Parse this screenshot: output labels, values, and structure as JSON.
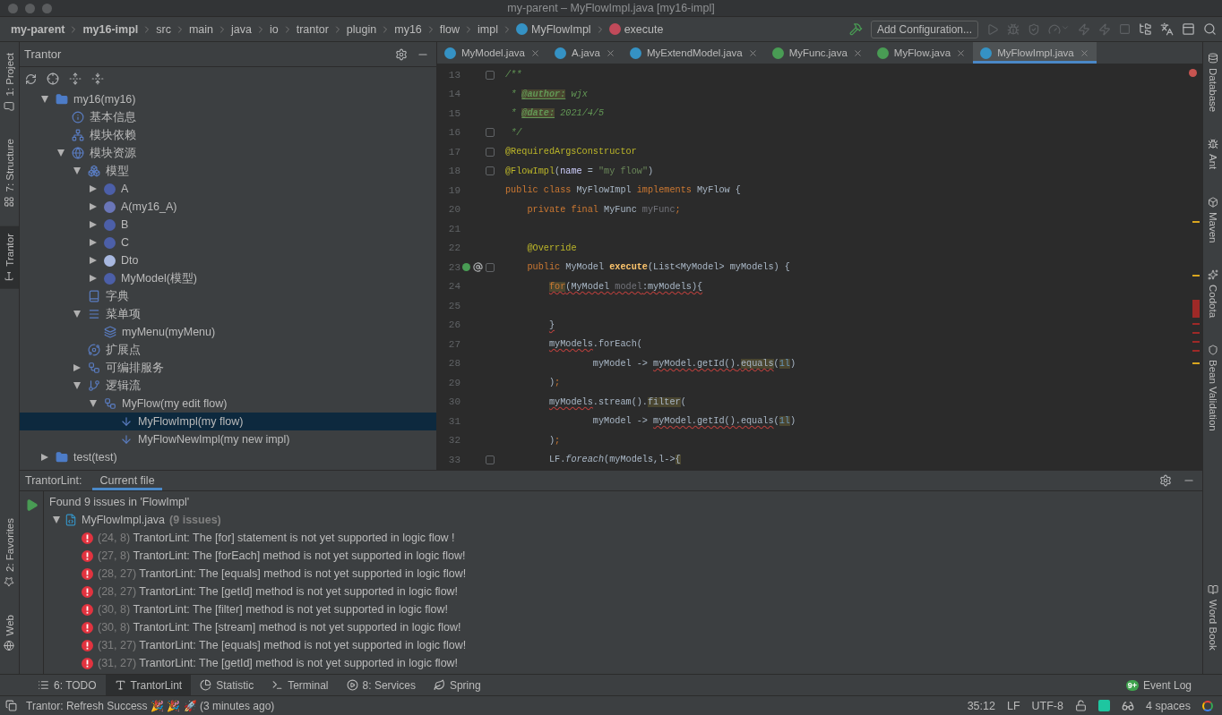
{
  "window": {
    "title": "my-parent – MyFlowImpl.java [my16-impl]"
  },
  "breadcrumbs": [
    {
      "text": "my-parent",
      "kind": "module"
    },
    {
      "text": "my16-impl",
      "kind": "module"
    },
    {
      "text": "src",
      "kind": "folder"
    },
    {
      "text": "main",
      "kind": "folder"
    },
    {
      "text": "java",
      "kind": "folder"
    },
    {
      "text": "io",
      "kind": "folder"
    },
    {
      "text": "trantor",
      "kind": "folder"
    },
    {
      "text": "plugin",
      "kind": "folder"
    },
    {
      "text": "my16",
      "kind": "folder"
    },
    {
      "text": "flow",
      "kind": "folder"
    },
    {
      "text": "impl",
      "kind": "folder"
    },
    {
      "text": "MyFlowImpl",
      "kind": "class"
    },
    {
      "text": "execute",
      "kind": "method"
    }
  ],
  "toolbar": {
    "run_config": "Add Configuration..."
  },
  "left_strip": [
    {
      "label": "1: Project",
      "kind": "folder",
      "selected": false
    },
    {
      "label": "7: Structure",
      "kind": "structure",
      "selected": false
    },
    {
      "label": "Trantor",
      "kind": "trantor",
      "selected": true
    }
  ],
  "left_strip_bottom": [
    {
      "label": "2: Favorites",
      "kind": "star",
      "selected": false
    },
    {
      "label": "Web",
      "kind": "globe",
      "selected": false
    }
  ],
  "right_strip": [
    {
      "label": "Database",
      "kind": "database"
    },
    {
      "label": "Ant",
      "kind": "bug"
    },
    {
      "label": "Maven",
      "kind": "box"
    },
    {
      "label": "Codota",
      "kind": "sparkle"
    },
    {
      "label": "Bean Validation",
      "kind": "shield"
    }
  ],
  "right_strip_bottom": [
    {
      "label": "Word Book",
      "kind": "book"
    }
  ],
  "tree_panel": {
    "title": "Trantor",
    "tree": [
      {
        "label": "my16(my16)",
        "kind": "folder",
        "expanded": true,
        "selected": false,
        "children": [
          {
            "label": "基本信息",
            "kind": "info",
            "selected": false
          },
          {
            "label": "模块依赖",
            "kind": "hierarchy",
            "selected": false
          },
          {
            "label": "模块资源",
            "kind": "globe",
            "expanded": true,
            "selected": false,
            "children": [
              {
                "label": "模型",
                "kind": "models",
                "expanded": true,
                "selected": false,
                "children": [
                  {
                    "label": "A",
                    "kind": "model",
                    "expanded": false,
                    "selected": false
                  },
                  {
                    "label": "A(my16_A)",
                    "kind": "entity",
                    "expanded": false,
                    "selected": false
                  },
                  {
                    "label": "B",
                    "kind": "model",
                    "expanded": false,
                    "selected": false
                  },
                  {
                    "label": "C",
                    "kind": "model",
                    "expanded": false,
                    "selected": false
                  },
                  {
                    "label": "Dto",
                    "kind": "dto",
                    "expanded": false,
                    "selected": false
                  },
                  {
                    "label": "MyModel(模型)",
                    "kind": "model",
                    "expanded": false,
                    "selected": false
                  }
                ]
              },
              {
                "label": "字典",
                "kind": "dict",
                "selected": false
              },
              {
                "label": "菜单项",
                "kind": "menu",
                "expanded": true,
                "selected": false,
                "children": [
                  {
                    "label": "myMenu(myMenu)",
                    "kind": "menuitem",
                    "selected": false
                  }
                ]
              },
              {
                "label": "扩展点",
                "kind": "extension",
                "selected": false
              },
              {
                "label": "可编排服务",
                "kind": "service",
                "expanded": false,
                "selected": false
              },
              {
                "label": "逻辑流",
                "kind": "flow",
                "expanded": true,
                "selected": false,
                "children": [
                  {
                    "label": "MyFlow(my edit flow)",
                    "kind": "flowdef",
                    "expanded": true,
                    "selected": false,
                    "children": [
                      {
                        "label": "MyFlowImpl(my flow)",
                        "kind": "impl",
                        "selected": true
                      },
                      {
                        "label": "MyFlowNewImpl(my new impl)",
                        "kind": "impl",
                        "selected": false
                      }
                    ]
                  }
                ]
              }
            ]
          }
        ]
      },
      {
        "label": "test(test)",
        "kind": "folder",
        "expanded": false,
        "selected": false
      }
    ]
  },
  "editor": {
    "tabs": [
      {
        "label": "MyModel.java",
        "kind": "class",
        "selected": false
      },
      {
        "label": "A.java",
        "kind": "class",
        "selected": false
      },
      {
        "label": "MyExtendModel.java",
        "kind": "class",
        "selected": false
      },
      {
        "label": "MyFunc.java",
        "kind": "interface",
        "selected": false
      },
      {
        "label": "MyFlow.java",
        "kind": "interface",
        "selected": false
      },
      {
        "label": "MyFlowImpl.java",
        "kind": "class",
        "selected": true
      }
    ],
    "lines": [
      {
        "number": "13",
        "fold": true,
        "tokens": [
          {
            "text": "/**",
            "kind": "doc",
            "error": false,
            "highlight": false
          }
        ]
      },
      {
        "number": "14",
        "fold": false,
        "tokens": [
          {
            "text": " * ",
            "kind": "doc",
            "error": false,
            "highlight": false
          },
          {
            "text": "@author:",
            "kind": "doctag",
            "error": false,
            "highlight": true
          },
          {
            "text": " wjx",
            "kind": "doc",
            "error": false,
            "highlight": false
          }
        ]
      },
      {
        "number": "15",
        "fold": false,
        "tokens": [
          {
            "text": " * ",
            "kind": "doc",
            "error": false,
            "highlight": false
          },
          {
            "text": "@date:",
            "kind": "doctag",
            "error": false,
            "highlight": true
          },
          {
            "text": " 2021/4/5",
            "kind": "doc",
            "error": false,
            "highlight": false
          }
        ]
      },
      {
        "number": "16",
        "fold": true,
        "tokens": [
          {
            "text": " */",
            "kind": "doc",
            "error": false,
            "highlight": false
          }
        ]
      },
      {
        "number": "17",
        "fold": true,
        "tokens": [
          {
            "text": "@RequiredArgsConstructor",
            "kind": "annotation",
            "error": false,
            "highlight": false
          }
        ]
      },
      {
        "number": "18",
        "fold": true,
        "tokens": [
          {
            "text": "@FlowImpl",
            "kind": "annotation",
            "error": false,
            "highlight": false
          },
          {
            "text": "(",
            "kind": "plain",
            "error": false,
            "highlight": false
          },
          {
            "text": "name",
            "kind": "param",
            "error": false,
            "highlight": false
          },
          {
            "text": " = ",
            "kind": "plain",
            "error": false,
            "highlight": false
          },
          {
            "text": "\"my flow\"",
            "kind": "string",
            "error": false,
            "highlight": false
          },
          {
            "text": ")",
            "kind": "plain",
            "error": false,
            "highlight": false
          }
        ]
      },
      {
        "number": "19",
        "fold": false,
        "tokens": [
          {
            "text": "public class ",
            "kind": "keyword",
            "error": false,
            "highlight": false
          },
          {
            "text": "MyFlowImpl ",
            "kind": "plain",
            "error": false,
            "highlight": false
          },
          {
            "text": "implements ",
            "kind": "keyword",
            "error": false,
            "highlight": false
          },
          {
            "text": "MyFlow {",
            "kind": "plain",
            "error": false,
            "highlight": false
          }
        ]
      },
      {
        "number": "20",
        "fold": false,
        "tokens": [
          {
            "text": "    private final ",
            "kind": "keyword",
            "error": false,
            "highlight": false
          },
          {
            "text": "MyFunc ",
            "kind": "plain",
            "error": false,
            "highlight": false
          },
          {
            "text": "myFunc",
            "kind": "unused",
            "error": false,
            "highlight": false
          },
          {
            "text": ";",
            "kind": "keyword",
            "error": false,
            "highlight": false
          }
        ]
      },
      {
        "number": "21",
        "fold": false
      },
      {
        "number": "22",
        "fold": false,
        "tokens": [
          {
            "text": "    @Override",
            "kind": "annotation",
            "error": false,
            "highlight": false
          }
        ]
      },
      {
        "number": "23",
        "fold": true,
        "kind": "override",
        "tokens": [
          {
            "text": "    public ",
            "kind": "keyword",
            "error": false,
            "highlight": false
          },
          {
            "text": "MyModel ",
            "kind": "plain",
            "error": false,
            "highlight": false
          },
          {
            "text": "execute",
            "kind": "method",
            "error": false,
            "highlight": false
          },
          {
            "text": "(List<MyModel> myModels) {",
            "kind": "plain",
            "error": false,
            "highlight": false
          }
        ]
      },
      {
        "number": "24",
        "fold": false,
        "tokens": [
          {
            "text": "        for",
            "kind": "keyword",
            "error": true,
            "highlight": true
          },
          {
            "text": "(MyModel ",
            "kind": "plain",
            "error": true,
            "highlight": false
          },
          {
            "text": "model",
            "kind": "unused",
            "error": true,
            "highlight": false
          },
          {
            "text": ":myModels){",
            "kind": "plain",
            "error": true,
            "highlight": false
          }
        ]
      },
      {
        "number": "25",
        "fold": false
      },
      {
        "number": "26",
        "fold": false,
        "tokens": [
          {
            "text": "        }",
            "kind": "plain",
            "error": true,
            "highlight": false
          }
        ]
      },
      {
        "number": "27",
        "fold": false,
        "tokens": [
          {
            "text": "        myModels",
            "kind": "plain",
            "error": true,
            "highlight": false
          },
          {
            "text": ".forEach(",
            "kind": "plain",
            "error": false,
            "highlight": false
          }
        ]
      },
      {
        "number": "28",
        "fold": false,
        "tokens": [
          {
            "text": "                myModel -> ",
            "kind": "plain",
            "error": false,
            "highlight": false
          },
          {
            "text": "myModel.getId()",
            "kind": "plain",
            "error": true,
            "highlight": false
          },
          {
            "text": ".",
            "kind": "plain",
            "error": true,
            "highlight": false
          },
          {
            "text": "equals",
            "kind": "plain",
            "error": true,
            "highlight": true
          },
          {
            "text": "(",
            "kind": "plain",
            "error": false,
            "highlight": false
          },
          {
            "text": "1l",
            "kind": "number",
            "error": false,
            "highlight": true
          },
          {
            "text": ")",
            "kind": "plain",
            "error": false,
            "highlight": false
          }
        ]
      },
      {
        "number": "29",
        "fold": false,
        "tokens": [
          {
            "text": "        )",
            "kind": "plain",
            "error": false,
            "highlight": false
          },
          {
            "text": ";",
            "kind": "keyword",
            "error": false,
            "highlight": false
          }
        ]
      },
      {
        "number": "30",
        "fold": false,
        "tokens": [
          {
            "text": "        myModels",
            "kind": "plain",
            "error": true,
            "highlight": false
          },
          {
            "text": ".stream().",
            "kind": "plain",
            "error": false,
            "highlight": false
          },
          {
            "text": "filter",
            "kind": "plain",
            "error": false,
            "highlight": true
          },
          {
            "text": "(",
            "kind": "plain",
            "error": false,
            "highlight": false
          }
        ]
      },
      {
        "number": "31",
        "fold": false,
        "tokens": [
          {
            "text": "                myModel -> ",
            "kind": "plain",
            "error": false,
            "highlight": false
          },
          {
            "text": "myModel.getId().equals",
            "kind": "plain",
            "error": true,
            "highlight": false
          },
          {
            "text": "(",
            "kind": "plain",
            "error": false,
            "highlight": false
          },
          {
            "text": "1l",
            "kind": "number",
            "error": false,
            "highlight": true
          },
          {
            "text": ")",
            "kind": "plain",
            "error": false,
            "highlight": false
          }
        ]
      },
      {
        "number": "32",
        "fold": false,
        "tokens": [
          {
            "text": "        )",
            "kind": "plain",
            "error": false,
            "highlight": false
          },
          {
            "text": ";",
            "kind": "keyword",
            "error": false,
            "highlight": false
          }
        ]
      },
      {
        "number": "33",
        "fold": true,
        "tokens": [
          {
            "text": "        LF.",
            "kind": "plain",
            "error": false,
            "highlight": false
          },
          {
            "text": "foreach",
            "kind": "static",
            "error": false,
            "highlight": false
          },
          {
            "text": "(myModels,l->",
            "kind": "plain",
            "error": false,
            "highlight": false
          },
          {
            "text": "{",
            "kind": "plain",
            "error": false,
            "highlight": true
          }
        ]
      }
    ]
  },
  "lint_panel": {
    "title": "TrantorLint:",
    "tabs": [
      {
        "label": "Current file",
        "selected": true
      }
    ],
    "summary": "Found 9 issues in 'FlowImpl'",
    "file": {
      "name": "MyFlowImpl.java",
      "count": "(9 issues)",
      "expanded": true
    },
    "issues": [
      {
        "location": "(24, 8)",
        "message": "TrantorLint: The [for] statement is not yet supported in logic flow !"
      },
      {
        "location": "(27, 8)",
        "message": "TrantorLint: The [forEach] method is not yet supported in logic flow!"
      },
      {
        "location": "(28, 27)",
        "message": "TrantorLint: The [equals] method is not yet supported in logic flow!"
      },
      {
        "location": "(28, 27)",
        "message": "TrantorLint: The [getId] method is not yet supported in logic flow!"
      },
      {
        "location": "(30, 8)",
        "message": "TrantorLint: The [filter] method is not yet supported in logic flow!"
      },
      {
        "location": "(30, 8)",
        "message": "TrantorLint: The [stream] method is not yet supported in logic flow!"
      },
      {
        "location": "(31, 27)",
        "message": "TrantorLint: The [equals] method is not yet supported in logic flow!"
      },
      {
        "location": "(31, 27)",
        "message": "TrantorLint: The [getId] method is not yet supported in logic flow!"
      }
    ]
  },
  "tool_tabs": [
    {
      "label": "6: TODO",
      "kind": "list",
      "selected": false
    },
    {
      "label": "TrantorLint",
      "kind": "trantor",
      "selected": true
    },
    {
      "label": "Statistic",
      "kind": "pie",
      "selected": false
    },
    {
      "label": "Terminal",
      "kind": "terminal",
      "selected": false
    },
    {
      "label": "8: Services",
      "kind": "play",
      "selected": false
    },
    {
      "label": "Spring",
      "kind": "leaf",
      "selected": false
    }
  ],
  "event_log": {
    "label": "Event Log",
    "badge": "9+"
  },
  "status_bar": {
    "message": "Trantor: Refresh Success 🎉 🎉 🚀 (3 minutes ago)",
    "position": "35:12",
    "line_ending": "LF",
    "encoding": "UTF-8",
    "indent": "4 spaces"
  }
}
